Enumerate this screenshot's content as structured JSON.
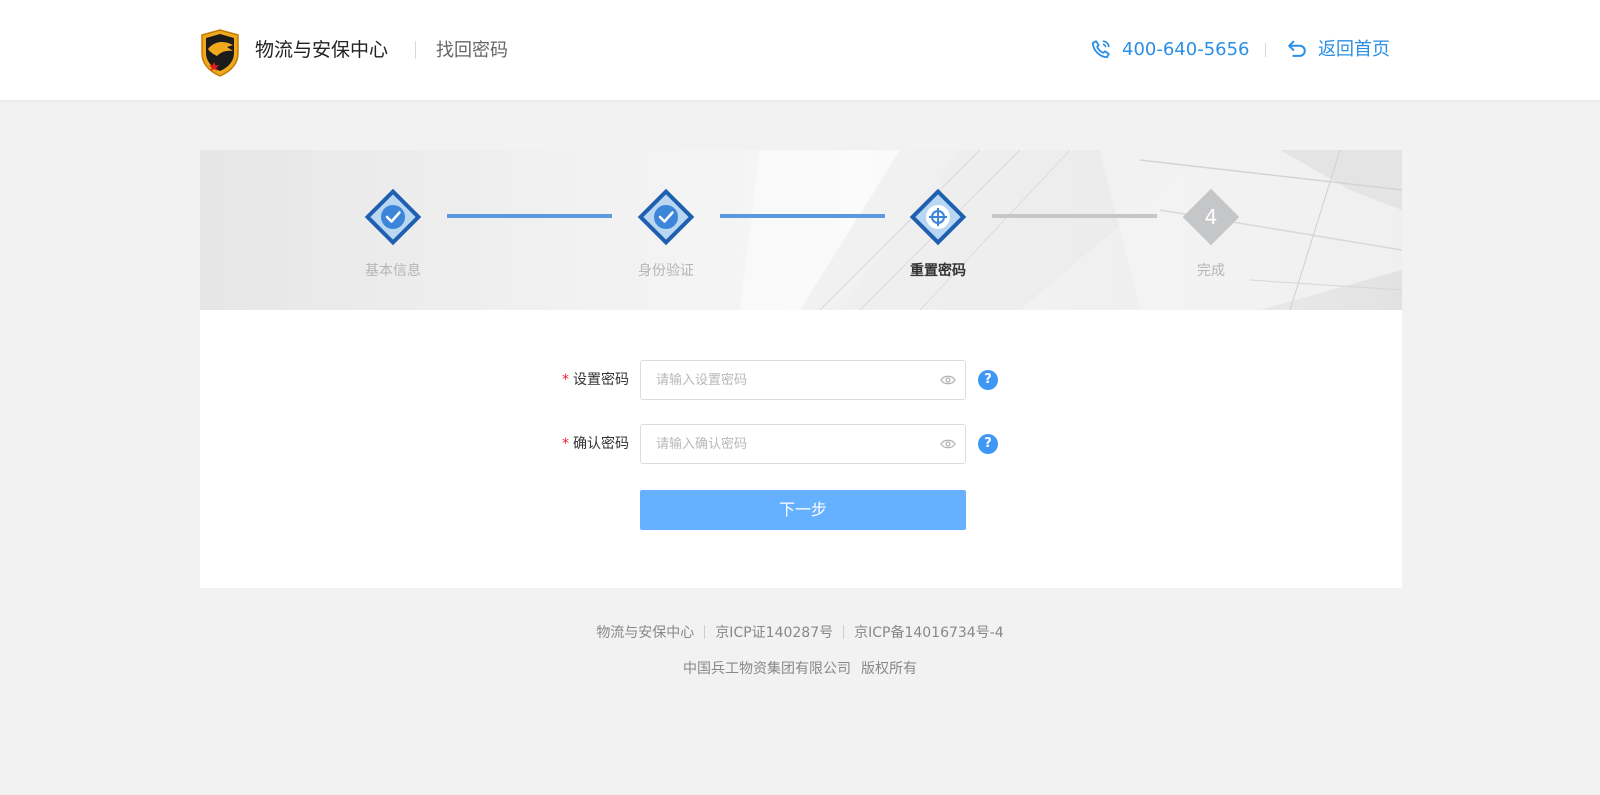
{
  "header": {
    "brand": "物流与安保中心",
    "subtitle": "找回密码",
    "phone": "400-640-5656",
    "back_label": "返回首页",
    "accent": "#2a8fe6"
  },
  "steps": [
    {
      "label": "基本信息",
      "state": "done"
    },
    {
      "label": "身份验证",
      "state": "done"
    },
    {
      "label": "重置密码",
      "state": "active"
    },
    {
      "label": "完成",
      "state": "pending",
      "number": "4"
    }
  ],
  "form": {
    "password": {
      "label": "设置密码",
      "required_mark": "*",
      "placeholder": "请输入设置密码",
      "value": ""
    },
    "confirm": {
      "label": "确认密码",
      "required_mark": "*",
      "placeholder": "请输入确认密码",
      "value": ""
    },
    "help_glyph": "?",
    "next_label": "下一步",
    "button_color": "#66b1ff"
  },
  "footer": {
    "links": [
      "物流与安保中心",
      "京ICP证140287号",
      "京ICP备14016734号-4"
    ],
    "company": "中国兵工物资集团有限公司",
    "rights": "版权所有"
  }
}
